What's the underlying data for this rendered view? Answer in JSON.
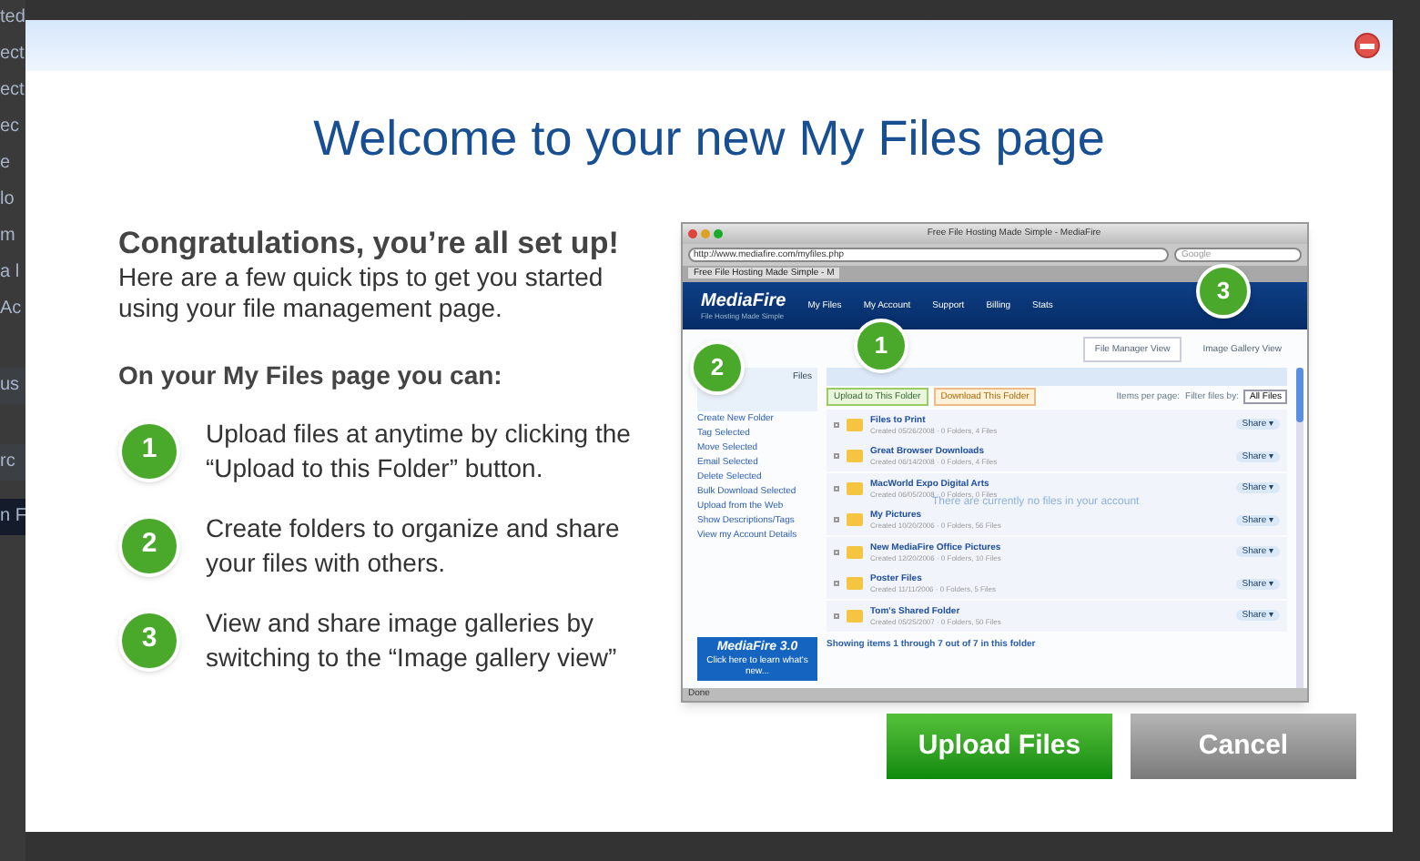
{
  "background_fragments": [
    "ted",
    "ect",
    "ect",
    "ec",
    "e",
    "lo",
    "m",
    "a l",
    "Ac",
    "us",
    "rc",
    "n F"
  ],
  "dialog": {
    "title": "Welcome to your new My Files page",
    "heading": "Congratulations, you’re all set up!",
    "intro": "Here are a few quick tips to get you started using your file management page.",
    "subheading": "On your My Files page you can:",
    "tips": [
      {
        "number": "1",
        "text": "Upload files at anytime by clicking the “Upload to this Folder” button."
      },
      {
        "number": "2",
        "text": "Create folders to organize and share your files with others."
      },
      {
        "number": "3",
        "text": "View and share image galleries by switching to the “Image gallery view”"
      }
    ],
    "buttons": [
      {
        "kind": "primary",
        "label": "Upload Files"
      },
      {
        "kind": "secondary",
        "label": "Cancel"
      }
    ]
  },
  "preview": {
    "window_title": "Free File Hosting Made Simple - MediaFire",
    "url": "http://www.mediafire.com/myfiles.php",
    "search_placeholder": "Google",
    "tab": "Free File Hosting Made Simple - M",
    "logo": "MediaFire",
    "tagline": "File Hosting Made Simple",
    "nav": [
      "My Files",
      "My Account",
      "Support",
      "Billing",
      "Stats"
    ],
    "views": [
      {
        "label": "File Manager View",
        "selected": true
      },
      {
        "label": "Image Gallery View",
        "selected": false
      }
    ],
    "sidebar_title": "Files",
    "actions": [
      "Create New Folder",
      "Tag Selected",
      "Move Selected",
      "Email Selected",
      "Delete Selected",
      "Bulk Download Selected",
      "Upload from the Web",
      "Show Descriptions/Tags",
      "View my Account Details"
    ],
    "banner_title": "MediaFire 3.0",
    "banner_text": "Click here to learn what's new...",
    "toolbar_buttons": [
      "Upload to This Folder",
      "Download This Folder"
    ],
    "items_per_page": "Items per page:",
    "filter": "Filter files by:",
    "filter_value": "All Files",
    "folders": [
      {
        "name": "Files to Print",
        "meta": "Created 05/26/2008 · 0 Folders, 4 Files",
        "share": "Share ▾"
      },
      {
        "name": "Great Browser Downloads",
        "meta": "Created 06/14/2008 · 0 Folders, 4 Files",
        "share": "Share ▾"
      },
      {
        "name": "MacWorld Expo Digital Arts",
        "meta": "Created 06/05/2008 · 0 Folders, 0 Files",
        "share": "Share ▾"
      },
      {
        "name": "My Pictures",
        "meta": "Created 10/20/2006 · 0 Folders, 56 Files",
        "share": "Share ▾"
      },
      {
        "name": "New MediaFire Office Pictures",
        "meta": "Created 12/20/2006 · 0 Folders, 10 Files",
        "share": "Share ▾"
      },
      {
        "name": "Poster Files",
        "meta": "Created 11/11/2006 · 0 Folders, 5 Files",
        "share": "Share ▾"
      },
      {
        "name": "Tom's Shared Folder",
        "meta": "Created 05/25/2007 · 0 Folders, 50 Files",
        "share": "Share ▾"
      }
    ],
    "empty_message": "There are currently no files in your account",
    "footer": "Showing items 1 through 7 out of 7 in this folder",
    "status": "Done",
    "callouts": [
      "1",
      "2",
      "3"
    ]
  }
}
